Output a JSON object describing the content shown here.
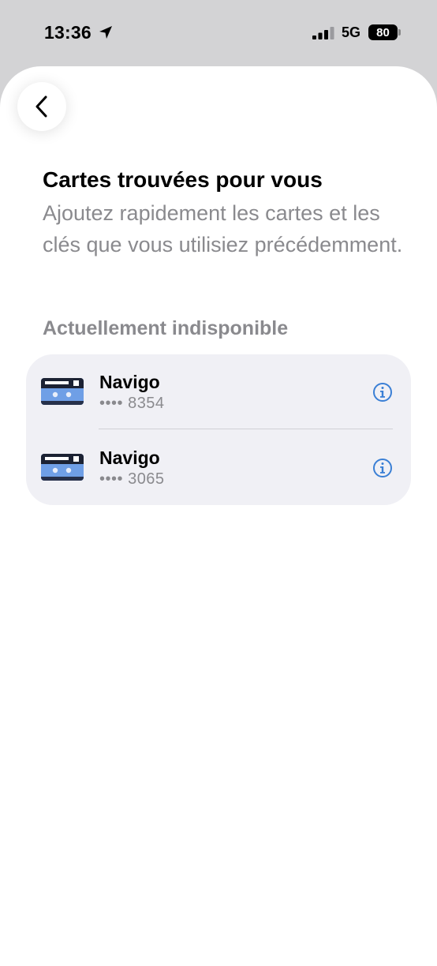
{
  "status_bar": {
    "time": "13:36",
    "network": "5G",
    "battery": "80"
  },
  "header": {
    "title": "Cartes trouvées pour vous",
    "subtitle": "Ajoutez rapidement les cartes et les clés que vous utilisiez précédemment."
  },
  "section": {
    "label": "Actuellement indisponible",
    "items": [
      {
        "name": "Navigo",
        "number": "•••• 8354"
      },
      {
        "name": "Navigo",
        "number": "•••• 3065"
      }
    ]
  },
  "colors": {
    "accent": "#3a7fd5",
    "secondary_text": "#8a8a8e",
    "list_bg": "#f0f0f5"
  }
}
